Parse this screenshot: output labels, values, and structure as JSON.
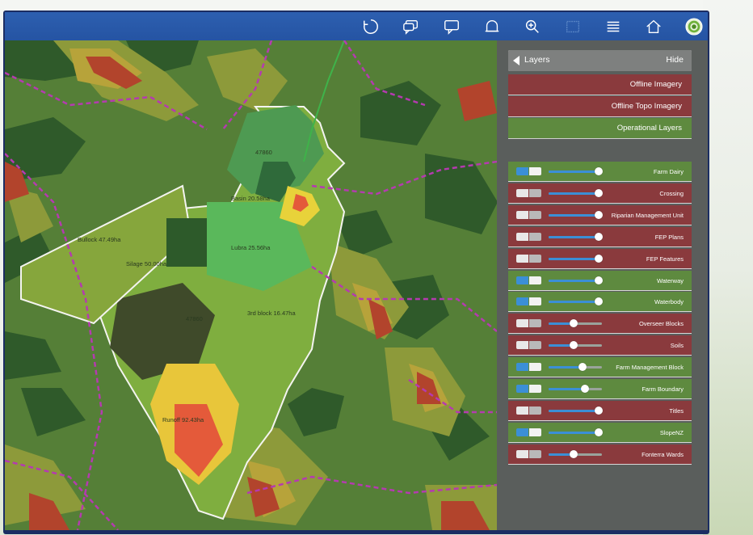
{
  "colors": {
    "accent": "#2554a3",
    "layer_on": "#3b8fd6",
    "red_row": "#8a3a3d",
    "green_row": "#5e8a3f"
  },
  "toolbar": {
    "icons": [
      "refresh-icon",
      "chat-bubbles-icon",
      "comment-icon",
      "bell-icon",
      "zoom-icon",
      "select-box-icon",
      "list-icon",
      "home-icon",
      "profile-icon"
    ]
  },
  "map": {
    "paddock_labels": [
      "47860",
      "Basin 20.58ha",
      "Bullock 47.49ha",
      "Silage 50.00ha",
      "Lubra 25.56ha",
      "47860",
      "3rd block 16.47ha",
      "Runoff 92.43ha"
    ]
  },
  "panel": {
    "header": {
      "title": "Layers",
      "hide": "Hide"
    },
    "base_layers": [
      {
        "label": "Offline Imagery",
        "state": "red"
      },
      {
        "label": "Offline Topo Imagery",
        "state": "red"
      },
      {
        "label": "Operational Layers",
        "state": "green"
      }
    ],
    "layers": [
      {
        "label": "Farm Dairy",
        "on": true,
        "opacity": 1.0
      },
      {
        "label": "Crossing",
        "on": false,
        "opacity": 1.0
      },
      {
        "label": "Riparian Management Unit",
        "on": false,
        "opacity": 1.0
      },
      {
        "label": "FEP Plans",
        "on": false,
        "opacity": 1.0
      },
      {
        "label": "FEP Features",
        "on": false,
        "opacity": 1.0
      },
      {
        "label": "Waterway",
        "on": true,
        "opacity": 1.0
      },
      {
        "label": "Waterbody",
        "on": true,
        "opacity": 1.0
      },
      {
        "label": "Overseer Blocks",
        "on": false,
        "opacity": 0.5
      },
      {
        "label": "Soils",
        "on": false,
        "opacity": 0.5
      },
      {
        "label": "Farm Management Block",
        "on": true,
        "opacity": 0.67
      },
      {
        "label": "Farm Boundary",
        "on": true,
        "opacity": 0.72
      },
      {
        "label": "Titles",
        "on": false,
        "opacity": 1.0
      },
      {
        "label": "SlopeNZ",
        "on": true,
        "opacity": 1.0
      },
      {
        "label": "Fonterra Wards",
        "on": false,
        "opacity": 0.5
      }
    ]
  }
}
